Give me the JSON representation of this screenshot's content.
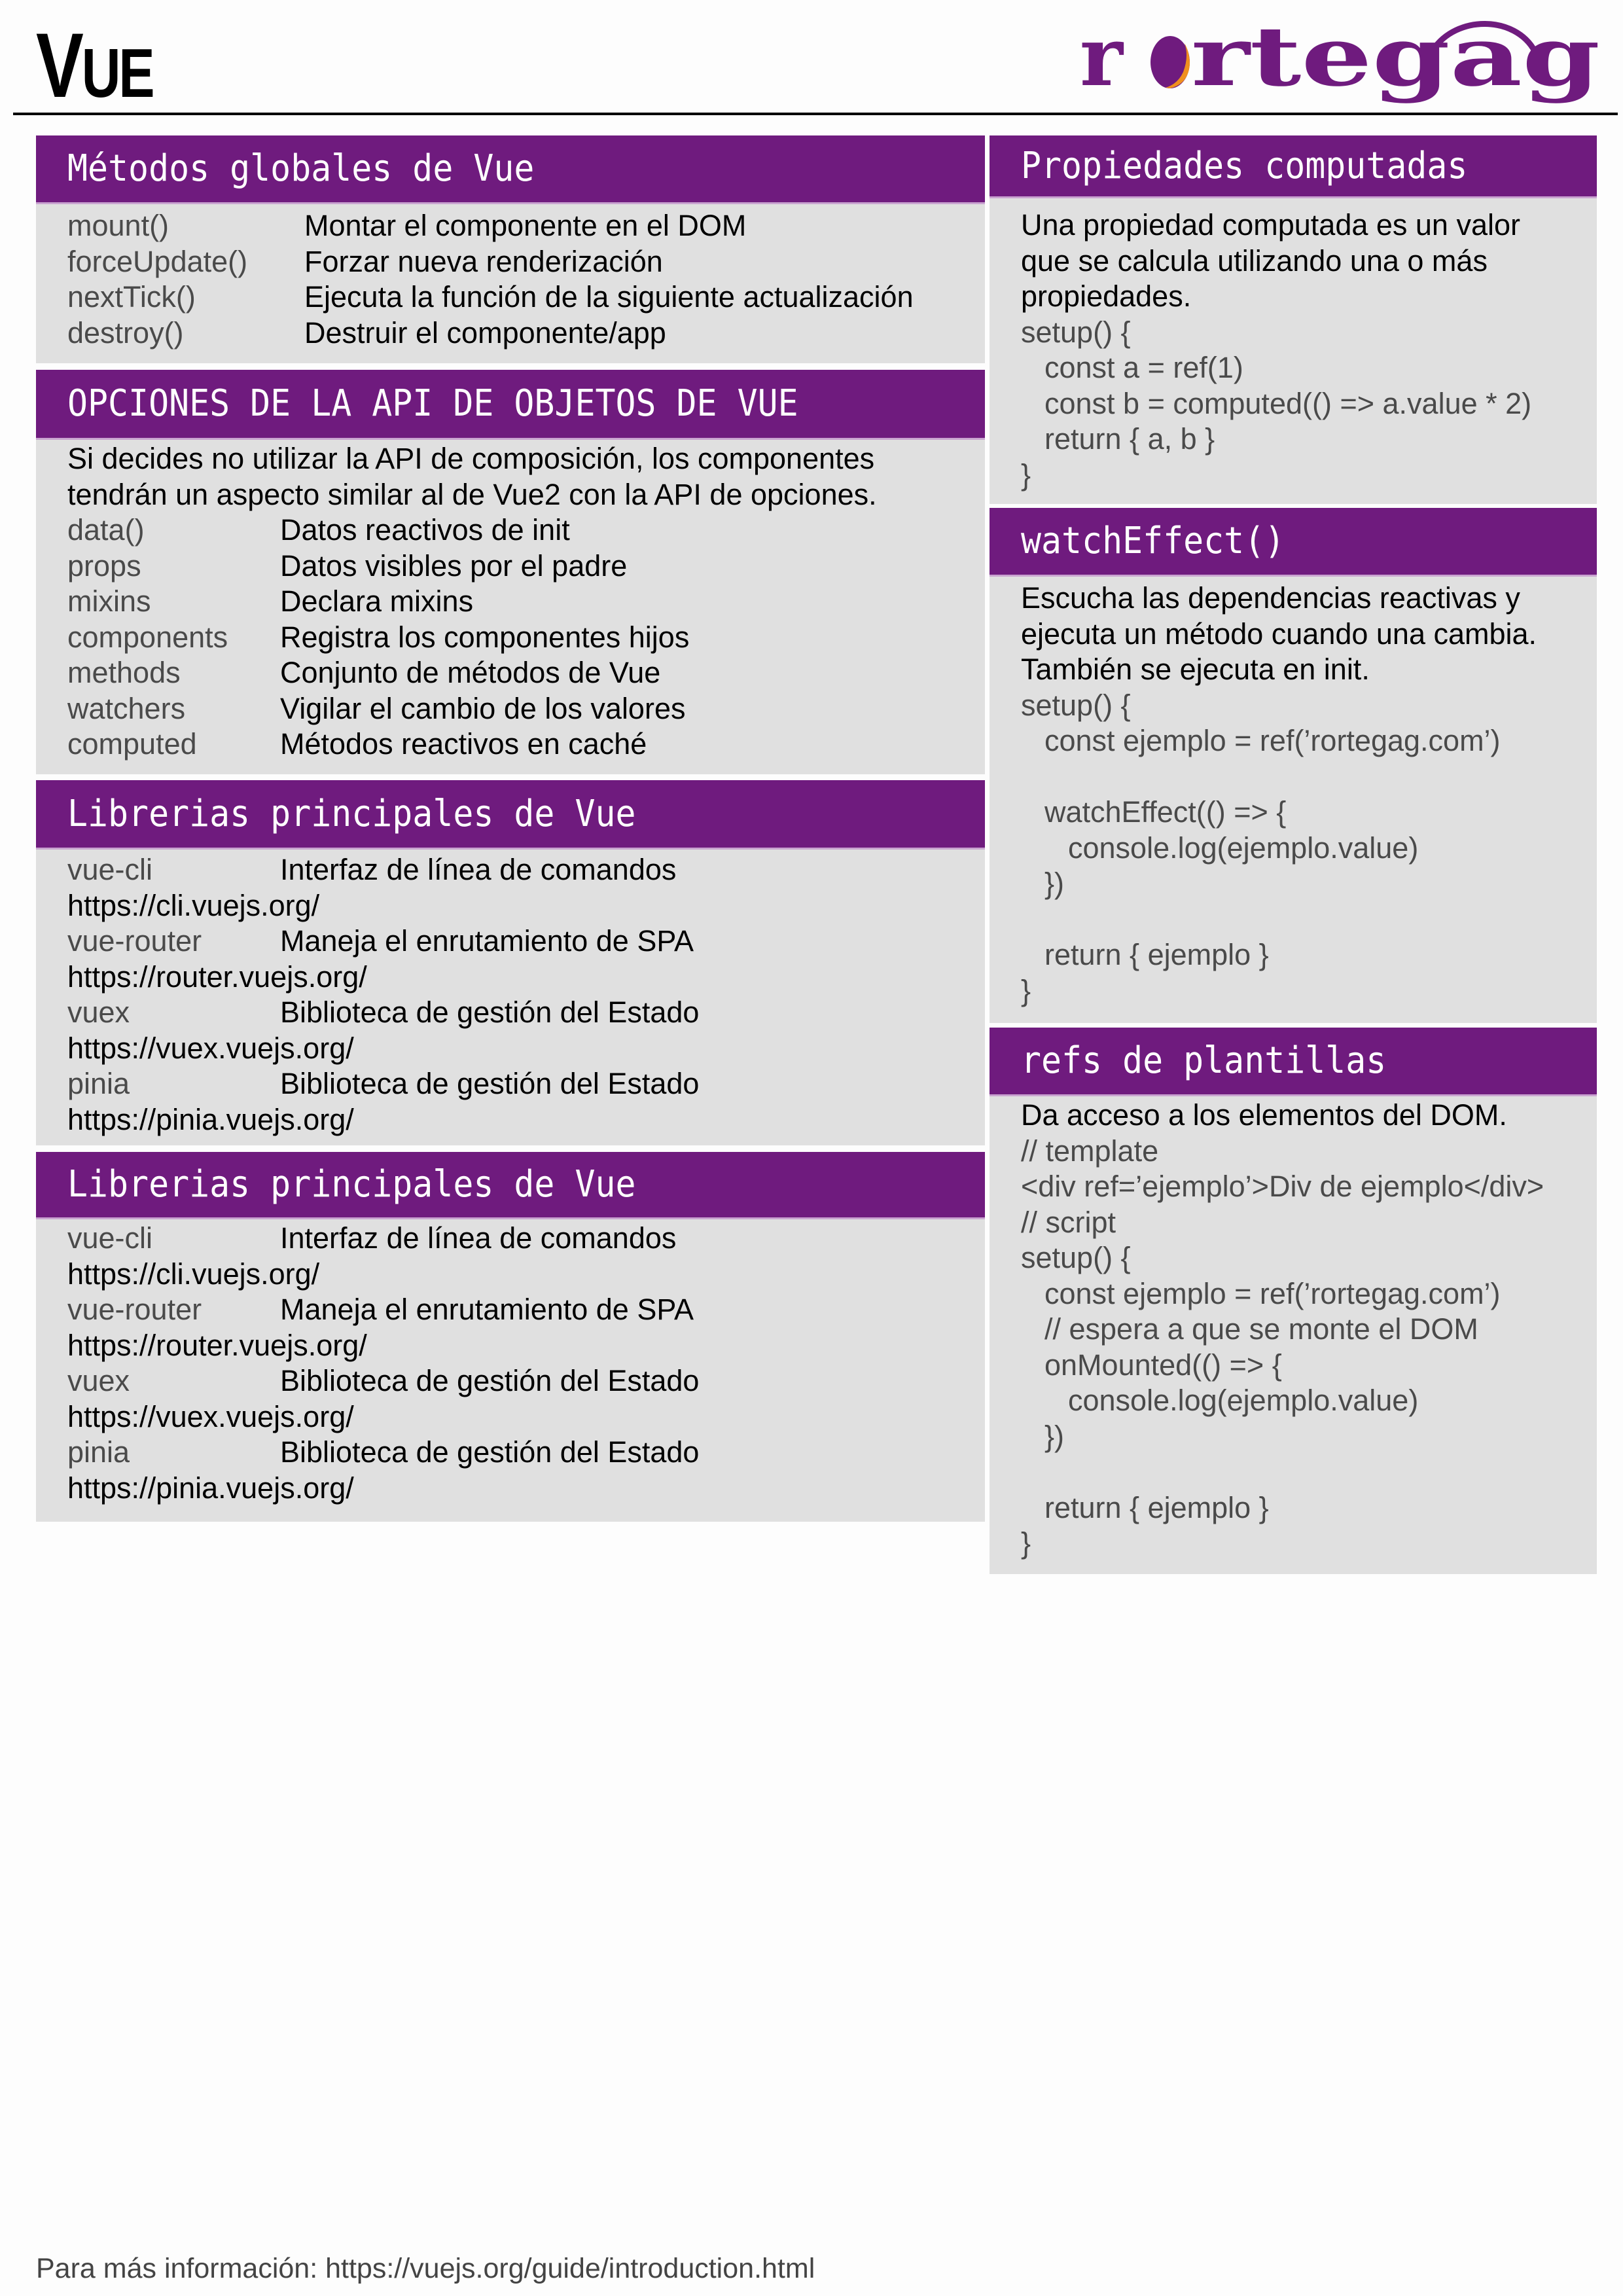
{
  "header": {
    "title_first": "V",
    "title_rest": "UE",
    "logo_text": "rortegag",
    "brand_color": "#6f1b7e",
    "accent_color": "#f0901e"
  },
  "sections": {
    "global_methods": {
      "title": "Métodos globales de Vue",
      "rows": [
        {
          "key": "mount()",
          "value": "Montar el componente en el DOM"
        },
        {
          "key": "forceUpdate()",
          "value": "Forzar nueva renderización"
        },
        {
          "key": "nextTick()",
          "value": "Ejecuta la función de la siguiente actualización"
        },
        {
          "key": "destroy()",
          "value": "Destruir el componente/app"
        }
      ]
    },
    "options_api": {
      "title": "OPCIONES DE LA API DE OBJETOS DE VUE",
      "intro": [
        "Si decides no utilizar la API de composición, los componentes",
        "tendrán un aspecto similar al de Vue2 con la API de opciones."
      ],
      "rows": [
        {
          "key": "data()",
          "value": "Datos reactivos de init"
        },
        {
          "key": "props",
          "value": "Datos visibles por el padre"
        },
        {
          "key": "mixins",
          "value": "Declara mixins"
        },
        {
          "key": "components",
          "value": "Registra los componentes hijos"
        },
        {
          "key": "methods",
          "value": "Conjunto de métodos de Vue"
        },
        {
          "key": "watchers",
          "value": "Vigilar el cambio de los valores"
        },
        {
          "key": "computed",
          "value": "Métodos reactivos en caché"
        }
      ]
    },
    "libraries_1": {
      "title": "Librerias principales de Vue",
      "rows": [
        {
          "key": "vue-cli",
          "value": "Interfaz de línea de comandos",
          "url": "https://cli.vuejs.org/"
        },
        {
          "key": "vue-router",
          "value": "Maneja el enrutamiento de SPA",
          "url": "https://router.vuejs.org/"
        },
        {
          "key": "vuex",
          "value": "Biblioteca de gestión del Estado",
          "url": "https://vuex.vuejs.org/"
        },
        {
          "key": "pinia",
          "value": "Biblioteca de gestión del Estado",
          "url": "https://pinia.vuejs.org/"
        }
      ]
    },
    "libraries_2": {
      "title": "Librerias principales de Vue",
      "rows": [
        {
          "key": "vue-cli",
          "value": "Interfaz de línea de comandos",
          "url": "https://cli.vuejs.org/"
        },
        {
          "key": "vue-router",
          "value": "Maneja el enrutamiento de SPA",
          "url": "https://router.vuejs.org/"
        },
        {
          "key": "vuex",
          "value": "Biblioteca de gestión del Estado",
          "url": "https://vuex.vuejs.org/"
        },
        {
          "key": "pinia",
          "value": "Biblioteca de gestión del Estado",
          "url": "https://pinia.vuejs.org/"
        }
      ]
    },
    "computed_props": {
      "title": "Propiedades computadas",
      "intro": [
        "Una propiedad computada es un valor",
        "que se calcula utilizando una o más",
        "propiedades."
      ],
      "code": [
        "setup() {",
        "const a = ref(1)",
        "const b = computed(() => a.value * 2)",
        "return { a, b }",
        "}"
      ]
    },
    "watch_effect": {
      "title": "watchEffect()",
      "intro": [
        "Escucha las dependencias reactivas y",
        "ejecuta un método cuando una cambia.",
        "También se ejecuta en init."
      ],
      "code": [
        "setup() {",
        "const ejemplo = ref(’rortegag.com’)",
        "",
        "watchEffect(() => {",
        "console.log(ejemplo.value)",
        "})",
        "",
        "return { ejemplo }",
        "}"
      ]
    },
    "template_refs": {
      "title": "refs de plantillas",
      "intro": [
        "Da acceso a los elementos del DOM."
      ],
      "code": [
        "// template",
        "<div ref=’ejemplo’>Div de ejemplo</div>",
        "// script",
        "setup() {",
        "const ejemplo = ref(’rortegag.com’)",
        "// espera a que se monte el DOM",
        "onMounted(() => {",
        "console.log(ejemplo.value)",
        "})",
        "",
        "return { ejemplo }",
        "}"
      ]
    }
  },
  "footer": {
    "text": "Para más información: https://vuejs.org/guide/introduction.html"
  }
}
